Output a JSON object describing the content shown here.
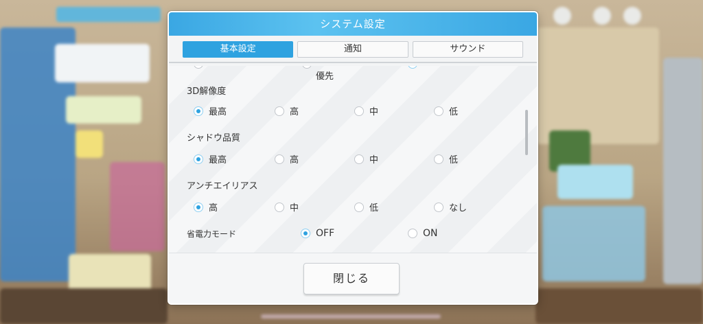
{
  "window": {
    "title": "システム設定"
  },
  "tabs": [
    {
      "label": "基本設定",
      "active": true
    },
    {
      "label": "通知",
      "active": false
    },
    {
      "label": "サウンド",
      "active": false
    }
  ],
  "partial_row": {
    "sub_label": "優先"
  },
  "sections": [
    {
      "title": "3D解像度",
      "options": [
        "最高",
        "高",
        "中",
        "低"
      ],
      "selected": "最高"
    },
    {
      "title": "シャドウ品質",
      "options": [
        "最高",
        "高",
        "中",
        "低"
      ],
      "selected": "最高"
    },
    {
      "title": "アンチエイリアス",
      "options": [
        "高",
        "中",
        "低",
        "なし"
      ],
      "selected": "高"
    },
    {
      "title": "省電力モード",
      "options": [
        "OFF",
        "ON"
      ],
      "selected": "OFF"
    }
  ],
  "footer": {
    "close_label": "閉じる"
  },
  "colors": {
    "accent": "#2ea2e0",
    "header": "#3aa7e3"
  }
}
